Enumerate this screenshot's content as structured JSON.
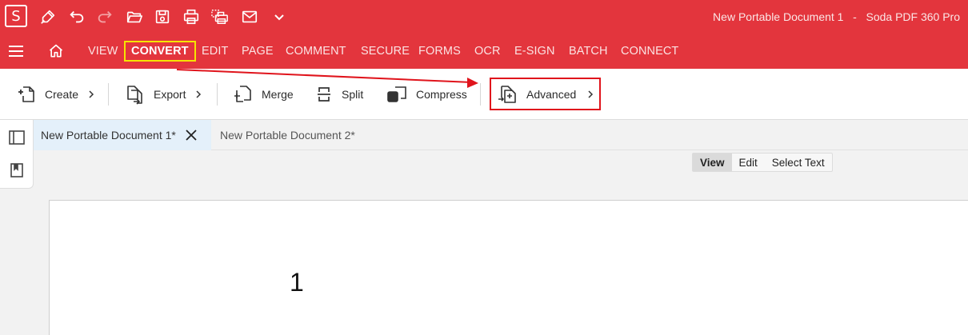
{
  "window": {
    "app_logo": "S",
    "document_title": "New Portable Document 1",
    "separator": "-",
    "app_name": "Soda PDF 360 Pro"
  },
  "quick_access": [
    {
      "name": "pen-icon"
    },
    {
      "name": "undo-icon"
    },
    {
      "name": "redo-icon"
    },
    {
      "name": "open-folder-icon"
    },
    {
      "name": "save-icon"
    },
    {
      "name": "print-icon"
    },
    {
      "name": "print-preview-icon"
    },
    {
      "name": "mail-icon"
    },
    {
      "name": "chevron-down-icon"
    }
  ],
  "menu": {
    "tabs": [
      {
        "label": "VIEW"
      },
      {
        "label": "CONVERT",
        "active": true
      },
      {
        "label": "EDIT"
      },
      {
        "label": "PAGE"
      },
      {
        "label": "COMMENT"
      },
      {
        "label": "SECURE"
      },
      {
        "label": "FORMS"
      },
      {
        "label": "OCR"
      },
      {
        "label": "E-SIGN"
      },
      {
        "label": "BATCH"
      },
      {
        "label": "CONNECT"
      }
    ]
  },
  "ribbon": {
    "create_label": "Create",
    "export_label": "Export",
    "merge_label": "Merge",
    "split_label": "Split",
    "compress_label": "Compress",
    "advanced_label": "Advanced"
  },
  "document_tabs": [
    {
      "label": "New Portable Document 1*",
      "active": true
    },
    {
      "label": "New Portable Document 2*",
      "active": false
    }
  ],
  "view_mode": {
    "options": [
      "View",
      "Edit",
      "Select Text"
    ],
    "selected": "View"
  },
  "page": {
    "content": "1"
  },
  "colors": {
    "brand_red": "#e3353d",
    "highlight_yellow": "#f5e400",
    "annotation_red": "#e0141c",
    "active_tab_bg": "#e4f0fa"
  }
}
